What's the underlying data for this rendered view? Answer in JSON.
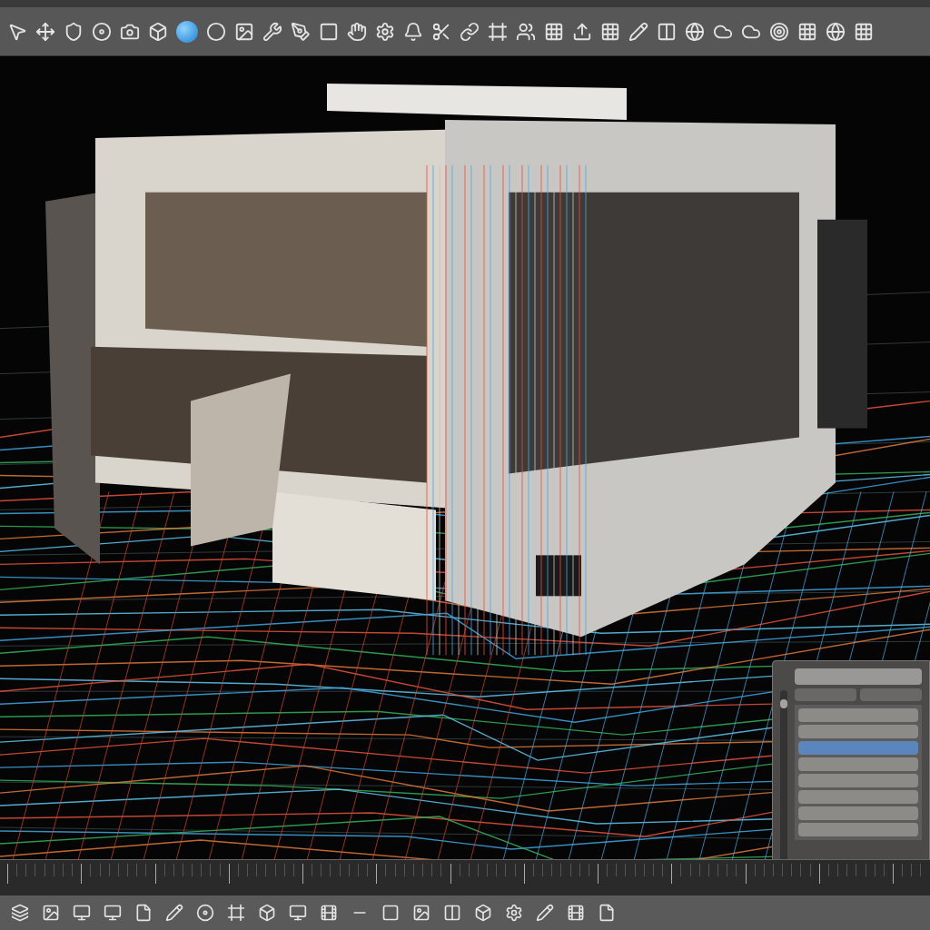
{
  "top_toolbar": [
    {
      "kind": "pointer"
    },
    {
      "kind": "move"
    },
    {
      "kind": "shield"
    },
    {
      "kind": "disc"
    },
    {
      "kind": "camera"
    },
    {
      "kind": "box"
    },
    {
      "kind": "sphere"
    },
    {
      "kind": "circle"
    },
    {
      "kind": "image"
    },
    {
      "kind": "wrench"
    },
    {
      "kind": "pen"
    },
    {
      "kind": "square"
    },
    {
      "kind": "hand"
    },
    {
      "kind": "gear"
    },
    {
      "kind": "bell"
    },
    {
      "kind": "scissors"
    },
    {
      "kind": "link"
    },
    {
      "kind": "frame"
    },
    {
      "kind": "users"
    },
    {
      "kind": "grid"
    },
    {
      "kind": "upload"
    },
    {
      "kind": "grid"
    },
    {
      "kind": "pencil"
    },
    {
      "kind": "columns"
    },
    {
      "kind": "globe"
    },
    {
      "kind": "cloud"
    },
    {
      "kind": "cloud"
    },
    {
      "kind": "target"
    },
    {
      "kind": "grid"
    },
    {
      "kind": "globe"
    },
    {
      "kind": "grid"
    }
  ],
  "panel": {
    "slider": {
      "level": 0.95
    },
    "rows": [
      {
        "selected": false
      },
      {
        "selected": false
      },
      {
        "selected": true
      },
      {
        "selected": false
      },
      {
        "selected": false
      },
      {
        "selected": false
      },
      {
        "selected": false
      },
      {
        "selected": false
      }
    ]
  },
  "bottom_toolbar": [
    {
      "kind": "layers"
    },
    {
      "kind": "image"
    },
    {
      "kind": "monitor"
    },
    {
      "kind": "monitor"
    },
    {
      "kind": "file"
    },
    {
      "kind": "pencil"
    },
    {
      "kind": "disc"
    },
    {
      "kind": "frame"
    },
    {
      "kind": "box"
    },
    {
      "kind": "monitor"
    },
    {
      "kind": "film"
    },
    {
      "kind": "minus"
    },
    {
      "kind": "square"
    },
    {
      "kind": "image"
    },
    {
      "kind": "columns"
    },
    {
      "kind": "box"
    },
    {
      "kind": "gear"
    },
    {
      "kind": "pencil"
    },
    {
      "kind": "film"
    },
    {
      "kind": "file"
    }
  ]
}
